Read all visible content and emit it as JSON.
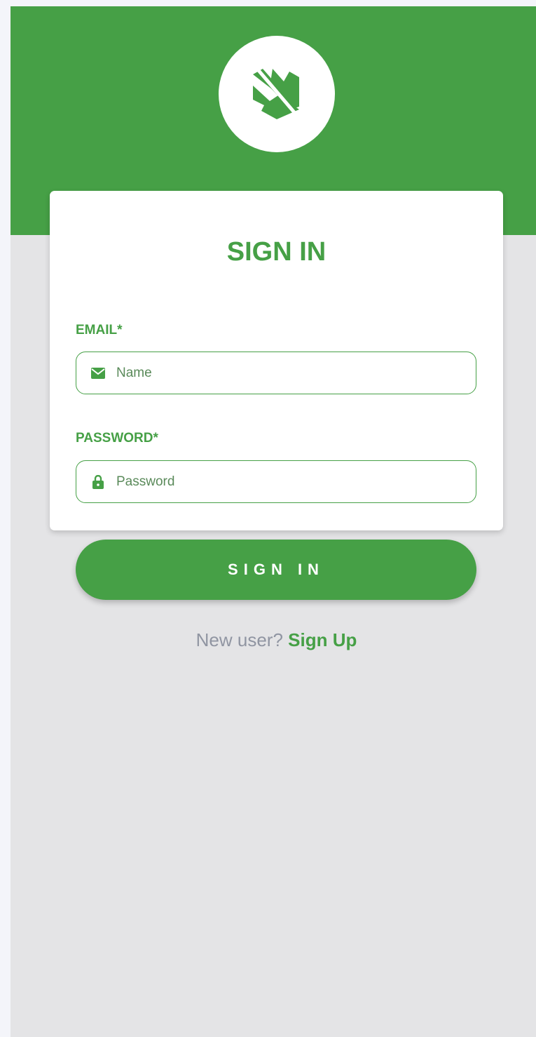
{
  "colors": {
    "brand_green": "#46a046",
    "background": "#e4e4e6",
    "card": "#ffffff",
    "muted_text": "#9095a2"
  },
  "header": {
    "logo_icon": "crown-shield-logo-icon"
  },
  "form": {
    "title": "SIGN IN",
    "email": {
      "label": "EMAIL*",
      "icon": "envelope-icon",
      "placeholder": "Name"
    },
    "password": {
      "label": "PASSWORD*",
      "icon": "lock-icon",
      "placeholder": "Password"
    },
    "submit_label": "SIGN IN",
    "signup_prompt": "New user?",
    "signup_link": "Sign Up"
  }
}
